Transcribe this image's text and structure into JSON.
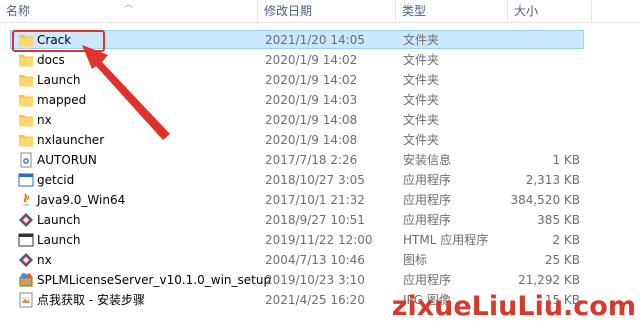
{
  "columns": {
    "name": "名称",
    "date": "修改日期",
    "type": "类型",
    "size": "大小"
  },
  "files": [
    {
      "name": "Crack",
      "date": "2021/1/20 14:05",
      "type": "文件夹",
      "size": "",
      "icon": "folder-icon"
    },
    {
      "name": "docs",
      "date": "2020/1/9 14:02",
      "type": "文件夹",
      "size": "",
      "icon": "folder-icon"
    },
    {
      "name": "Launch",
      "date": "2020/1/9 14:02",
      "type": "文件夹",
      "size": "",
      "icon": "folder-icon"
    },
    {
      "name": "mapped",
      "date": "2020/1/9 14:03",
      "type": "文件夹",
      "size": "",
      "icon": "folder-icon"
    },
    {
      "name": "nx",
      "date": "2020/1/9 14:08",
      "type": "文件夹",
      "size": "",
      "icon": "folder-icon"
    },
    {
      "name": "nxlauncher",
      "date": "2020/1/9 14:08",
      "type": "文件夹",
      "size": "",
      "icon": "folder-icon"
    },
    {
      "name": "AUTORUN",
      "date": "2017/7/18 2:26",
      "type": "安装信息",
      "size": "1 KB",
      "icon": "setup-info-icon"
    },
    {
      "name": "getcid",
      "date": "2018/10/27 3:05",
      "type": "应用程序",
      "size": "2,313 KB",
      "icon": "app-icon"
    },
    {
      "name": "Java9.0_Win64",
      "date": "2017/10/1 21:32",
      "type": "应用程序",
      "size": "384,520 KB",
      "icon": "java-icon"
    },
    {
      "name": "Launch",
      "date": "2018/9/27 10:51",
      "type": "应用程序",
      "size": "385 KB",
      "icon": "nx-app-icon"
    },
    {
      "name": "Launch",
      "date": "2019/11/22 12:00",
      "type": "HTML 应用程序",
      "size": "2 KB",
      "icon": "hta-icon"
    },
    {
      "name": "nx",
      "date": "2004/7/13 10:46",
      "type": "图标",
      "size": "25 KB",
      "icon": "nx-icon"
    },
    {
      "name": "SPLMLicenseServer_v10.1.0_win_setup",
      "date": "2019/10/23 3:10",
      "type": "应用程序",
      "size": "21,292 KB",
      "icon": "installer-icon"
    },
    {
      "name": "点我获取 - 安装步骤",
      "date": "2021/4/25 16:20",
      "type": "JPG 图像",
      "size": "15 KB",
      "icon": "image-icon"
    }
  ],
  "watermark": "zixueLiuLiu.com",
  "colors": {
    "selection": "#cce8ff",
    "annotation": "#e0322b",
    "folder": "#f5c443"
  }
}
